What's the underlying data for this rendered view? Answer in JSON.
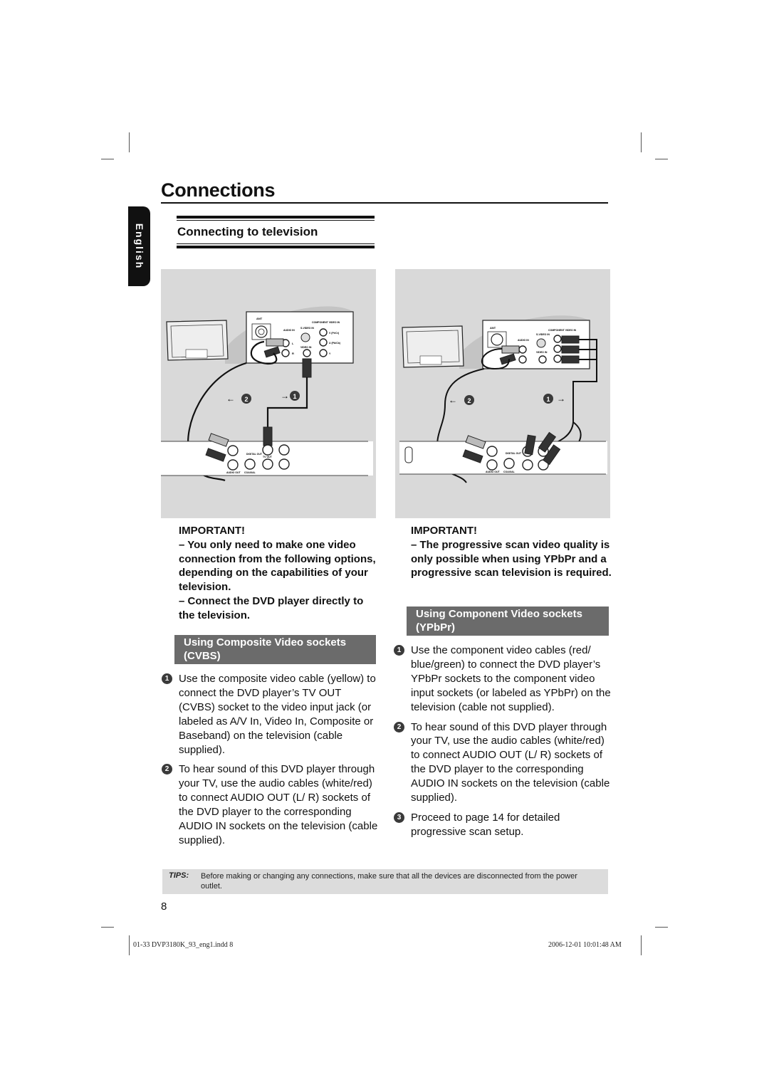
{
  "header": {
    "chapter_title": "Connections",
    "language_tab": "English",
    "section_title": "Connecting to television"
  },
  "left_column": {
    "figure_labels": {
      "ant": "ANT",
      "audio_in": "AUDIO IN",
      "s_video_in": "S-VIDEO IN",
      "video_in": "VIDEO IN",
      "component_video_in": "COMPONENT VIDEO IN",
      "y_pr": "V (Pr/Cr)",
      "u_pb": "U (Pb/Cb)",
      "y": "Y",
      "l": "L",
      "r": "R",
      "digital_out": "DIGITAL OUT",
      "coaxial": "COAXIAL",
      "audio_out": "AUDIO OUT",
      "tv_out": "TV OUT",
      "pb": "Pb",
      "pr": "Pr",
      "marker_1": "1",
      "marker_2": "2"
    },
    "important_heading": "IMPORTANT!",
    "important_lines": [
      "– You only need to make one video connection from the following options, depending on the capabilities of your television.",
      "– Connect the DVD player directly to the television."
    ],
    "band_title": "Using Composite Video sockets (CVBS)",
    "steps": [
      {
        "num": "1",
        "text": "Use the composite video cable (yellow) to connect the DVD player’s TV OUT (CVBS) socket to the video input jack (or labeled as A/V In, Video In, Composite or Baseband) on the television (cable supplied)."
      },
      {
        "num": "2",
        "text": "To hear sound of this DVD player through your TV, use the audio cables (white/red) to connect AUDIO OUT (L/ R) sockets of the DVD player to the corresponding AUDIO IN sockets on the television (cable supplied)."
      }
    ]
  },
  "right_column": {
    "important_heading": "IMPORTANT!",
    "important_lines": [
      "– The progressive scan video quality is only possible when using YPbPr and a progressive scan television is required."
    ],
    "band_title": "Using Component Video sockets (YPbPr)",
    "steps": [
      {
        "num": "1",
        "text": "Use the component video cables (red/ blue/green) to connect the DVD player’s YPbPr sockets to the component video input sockets (or labeled as YPbPr) on the television (cable not supplied)."
      },
      {
        "num": "2",
        "text": "To hear sound of this DVD player through your TV, use the audio cables (white/red) to connect AUDIO OUT (L/ R) sockets of the DVD player to the corresponding AUDIO IN sockets on the television (cable supplied)."
      },
      {
        "num": "3",
        "text": "Proceed to page 14 for detailed progressive scan setup."
      }
    ]
  },
  "tips": {
    "label": "TIPS:",
    "text": "Before making or changing any connections, make sure that all the devices are disconnected from the power outlet."
  },
  "page_number": "8",
  "slug": {
    "file": "01-33 DVP3180K_93_eng1.indd   8",
    "timestamp": "2006-12-01   10:01:48 AM"
  }
}
